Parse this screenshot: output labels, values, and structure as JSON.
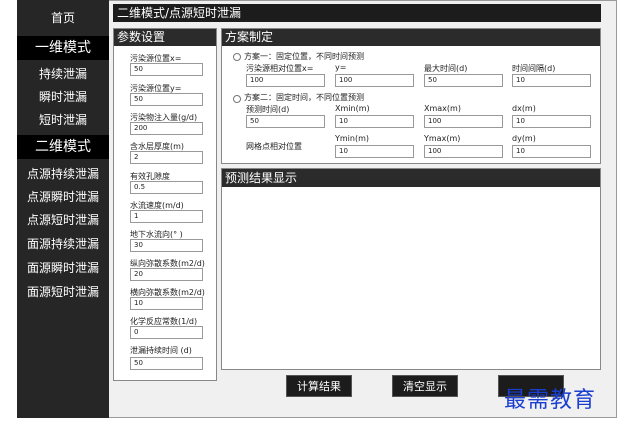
{
  "sidebar": {
    "home": "首页",
    "section1": "一维模式",
    "items1": [
      "持续泄漏",
      "瞬时泄漏",
      "短时泄漏"
    ],
    "section2": "二维模式",
    "items2": [
      "点源持续泄漏",
      "点源瞬时泄漏",
      "点源短时泄漏",
      "面源持续泄漏",
      "面源瞬时泄漏",
      "面源短时泄漏"
    ]
  },
  "title": "二维模式/点源短时泄漏",
  "params": {
    "title": "参数设置",
    "fields": [
      {
        "label": "污染源位置x=",
        "value": "50"
      },
      {
        "label": "污染源位置y=",
        "value": "50"
      },
      {
        "label": "污染物注入量(g/d)",
        "value": "200"
      },
      {
        "label": "含水层厚度(m)",
        "value": "2"
      },
      {
        "label": "有效孔隙度",
        "value": "0.5"
      },
      {
        "label": "水流速度(m/d)",
        "value": "1"
      },
      {
        "label": "地下水流向(° )",
        "value": "30"
      },
      {
        "label": "纵向弥散系数(m2/d)",
        "value": "20"
      },
      {
        "label": "横向弥散系数(m2/d)",
        "value": "10"
      },
      {
        "label": "化学反应常数(1/d)",
        "value": "0"
      },
      {
        "label": "泄漏持续时间 (d)",
        "value": "50"
      }
    ]
  },
  "scheme": {
    "title": "方案制定",
    "option1": "方案一：固定位置，不同时间预测",
    "option1_labels": [
      "污染源相对位置x=",
      "y=",
      "最大时间(d)",
      "时间间隔(d)"
    ],
    "option1_values": [
      "100",
      "100",
      "50",
      "10"
    ],
    "option2": "方案二：固定时间，不同位置预测",
    "option2_labels": [
      "预测时间(d)",
      "Xmin(m)",
      "Xmax(m)",
      "dx(m)"
    ],
    "option2_values": [
      "50",
      "10",
      "100",
      "10"
    ],
    "grid_label": "网格点相对位置",
    "option2_labels2": [
      "Ymin(m)",
      "Ymax(m)",
      "dy(m)"
    ],
    "option2_values2": [
      "10",
      "100",
      "10"
    ]
  },
  "result": {
    "title": "预测结果显示"
  },
  "buttons": {
    "compute": "计算结果",
    "clear": "清空显示",
    "other": ""
  },
  "watermark": "最需教育"
}
